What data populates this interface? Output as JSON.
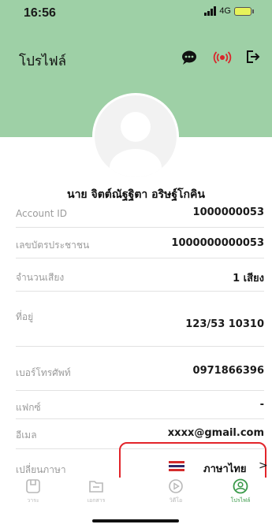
{
  "status_bar": {
    "time": "16:56",
    "network": "4G"
  },
  "header": {
    "title": "โปรไฟล์"
  },
  "profile": {
    "name": "นาย จิตต์ณัฐฐิตา อริษฐ์โกคิน"
  },
  "fields": [
    {
      "label": "Account ID",
      "value": "1000000053"
    },
    {
      "label": "เลขบัตรประชาชน",
      "value": "1000000000053"
    },
    {
      "label": "จำนวนเสียง",
      "value": "1 เสียง"
    },
    {
      "label": "ที่อยู่",
      "value": "123/53 10310"
    },
    {
      "label": "เบอร์โทรศัพท์",
      "value": "0971866396"
    },
    {
      "label": "แฟกซ์",
      "value": "-"
    },
    {
      "label": "อีเมล",
      "value": "xxxx@gmail.com"
    }
  ],
  "language": {
    "label": "เปลี่ยนภาษา",
    "value": "ภาษาไทย",
    "chevron": ">"
  },
  "tabs": [
    {
      "label": "วาระ",
      "icon": "agenda-icon"
    },
    {
      "label": "เอกสาร",
      "icon": "document-icon"
    },
    {
      "label": "วิดีโอ",
      "icon": "video-icon"
    },
    {
      "label": "โปรไฟล์",
      "icon": "profile-icon"
    }
  ],
  "colors": {
    "header_green": "#9ed0a6",
    "highlight_red": "#e2242a",
    "active_tab": "#3a9a4a"
  }
}
